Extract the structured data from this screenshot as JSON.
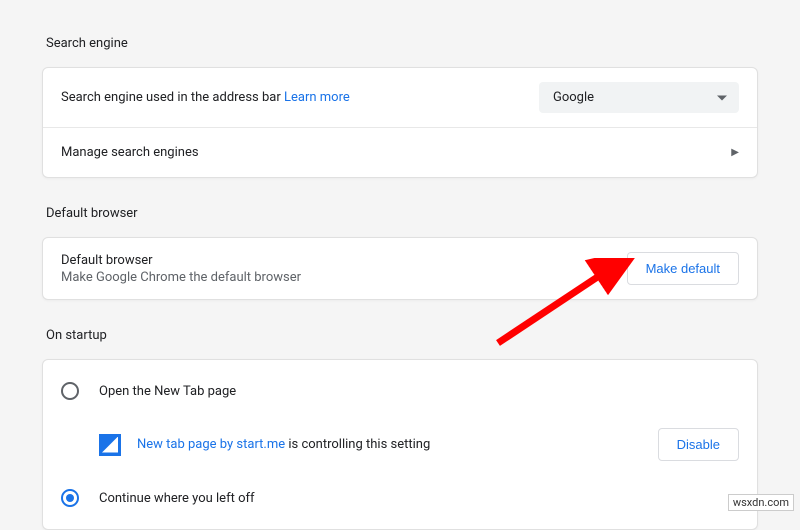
{
  "search": {
    "title": "Search engine",
    "used_label": "Search engine used in the address bar",
    "learn_more": "Learn more",
    "selected_engine": "Google",
    "manage_label": "Manage search engines"
  },
  "default_browser": {
    "title": "Default browser",
    "label": "Default browser",
    "sub": "Make Google Chrome the default browser",
    "button": "Make default"
  },
  "startup": {
    "title": "On startup",
    "options": [
      {
        "label": "Open the New Tab page",
        "checked": false
      },
      {
        "label": "Continue where you left off",
        "checked": true
      }
    ],
    "extension": {
      "name": "New tab page by start.me",
      "suffix": " is controlling this setting",
      "disable": "Disable"
    }
  },
  "watermark": "wsxdn.com"
}
